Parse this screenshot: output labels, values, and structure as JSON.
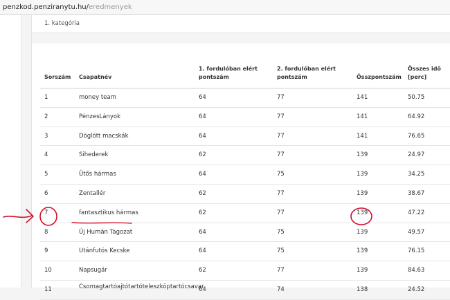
{
  "browser": {
    "url_host": "penzkod.penziranytu.hu/",
    "url_path": "eredmenyek"
  },
  "results": {
    "category_title": "1. kategória",
    "columns": {
      "rank": "Sorszám",
      "team": "Csapatnév",
      "round1_line1": "1. fordulóban elért",
      "round1_line2": "pontszám",
      "round2_line1": "2. fordulóban elért",
      "round2_line2": "pontszám",
      "total": "Összpontszám",
      "time_line1": "Összes idő",
      "time_line2": "[perc]"
    },
    "rows": [
      {
        "rank": "1",
        "team": "money team",
        "r1": "64",
        "r2": "77",
        "total": "141",
        "time": "50.75"
      },
      {
        "rank": "2",
        "team": "PénzesLányok",
        "r1": "64",
        "r2": "77",
        "total": "141",
        "time": "64.92"
      },
      {
        "rank": "3",
        "team": "Döglött macskák",
        "r1": "64",
        "r2": "77",
        "total": "141",
        "time": "76.65"
      },
      {
        "rank": "4",
        "team": "Sihederek",
        "r1": "62",
        "r2": "77",
        "total": "139",
        "time": "24.97"
      },
      {
        "rank": "5",
        "team": "Ütős hármas",
        "r1": "64",
        "r2": "75",
        "total": "139",
        "time": "34.25"
      },
      {
        "rank": "6",
        "team": "Zentallér",
        "r1": "62",
        "r2": "77",
        "total": "139",
        "time": "38.67"
      },
      {
        "rank": "7",
        "team": "fantasztikus hármas",
        "r1": "62",
        "r2": "77",
        "total": "139",
        "time": "47.22"
      },
      {
        "rank": "8",
        "team": "Új Humán Tagozat",
        "r1": "64",
        "r2": "75",
        "total": "139",
        "time": "49.57"
      },
      {
        "rank": "9",
        "team": "Utánfutós Kecske",
        "r1": "64",
        "r2": "75",
        "total": "139",
        "time": "76.15"
      },
      {
        "rank": "10",
        "team": "Napsugár",
        "r1": "62",
        "r2": "77",
        "total": "139",
        "time": "84.63"
      },
      {
        "rank": "11",
        "team": "Csomagtartóajtótartóteleszköptartócsavar",
        "r1": "64",
        "r2": "74",
        "total": "138",
        "time": "24.52"
      }
    ],
    "annotation_color": "#d0112b"
  }
}
